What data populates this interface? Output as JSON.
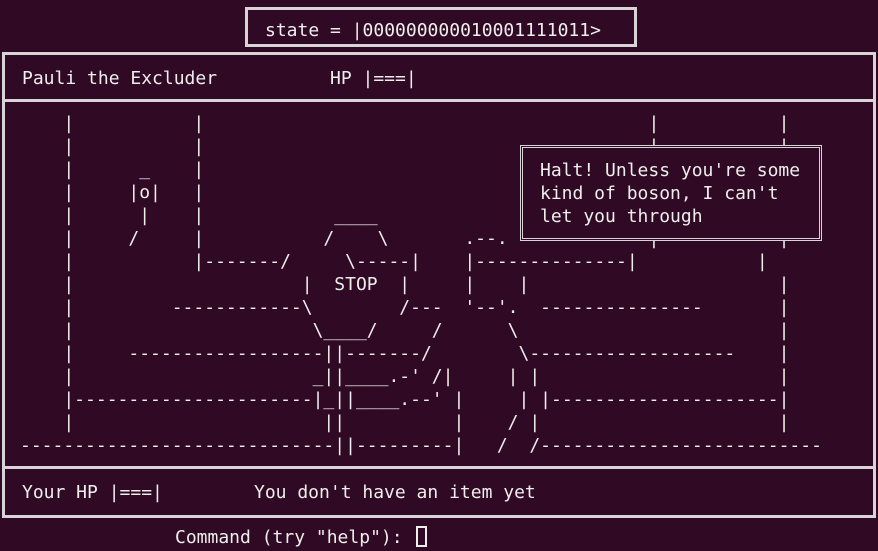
{
  "state": {
    "text": "state = |000000000010001111011>"
  },
  "enemy": {
    "name": "Pauli the Excluder",
    "hp_label": "HP |===|"
  },
  "scene": {
    "art": "    |           |                                         |           |\n    |           |                                         |           |\n    |      _    |                                         |           |\n    |     |o|   |                                         |           |\n    |      |    |            ____                         |           |\n    |     /     |           /    \\       .--.             |           |\n    |           |-------/     \\-----|    |--------------|           |\n    |                     |  STOP  |     |    |                       |\n    |         ------------\\        /---  '--'.  ---------------       |\n    |                      \\____/     /      \\                        |\n    |     ------------------||-------/        \\-------------------    |\n    |                      _||____.-' /|     | |                      |\n    |----------------------|_||____.--' |     | |---------------------|\n    |                       ||          |    / |                      |\n-----------------------------||---------|   /  /--------------------------"
  },
  "speech": {
    "lines": [
      "Halt! Unless you're some",
      "kind of boson, I can't",
      "let you through"
    ]
  },
  "player": {
    "hp_label": "Your HP |===|",
    "item_text": "You don't have an item yet"
  },
  "command": {
    "prompt": "Command (try \"help\"):"
  }
}
